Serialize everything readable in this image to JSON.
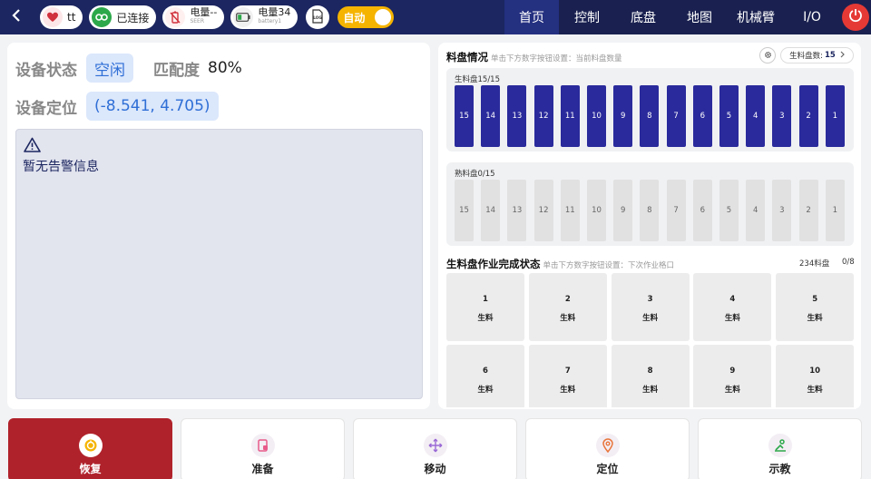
{
  "header": {
    "user": "tt",
    "connection": "已连接",
    "battery_a_label": "电量--",
    "battery_a_sub": "SEER",
    "battery_b_label": "电量34",
    "battery_b_sub": "battery1",
    "log_label": "LOG",
    "auto_label": "自动"
  },
  "nav": {
    "tabs": [
      "首页",
      "控制",
      "底盘",
      "地图",
      "机械臂",
      "I/O"
    ],
    "active": "首页"
  },
  "status": {
    "state_label": "设备状态",
    "state_value": "空闲",
    "match_label": "匹配度",
    "match_value": "80%",
    "position_label": "设备定位",
    "position_value": "(-8.541, 4.705)",
    "alarm_text": "暂无告警信息"
  },
  "trays": {
    "title": "料盘情况",
    "hint": "单击下方数字按钮设置：当前料盘数量",
    "count_label": "生料盘数:",
    "count_value": "15",
    "raw_caption": "生料盘15/15",
    "cooked_caption": "熟料盘0/15",
    "raw_slots": [
      "15",
      "14",
      "13",
      "12",
      "11",
      "10",
      "9",
      "8",
      "7",
      "6",
      "5",
      "4",
      "3",
      "2",
      "1"
    ],
    "cooked_slots": [
      "15",
      "14",
      "13",
      "12",
      "11",
      "10",
      "9",
      "8",
      "7",
      "6",
      "5",
      "4",
      "3",
      "2",
      "1"
    ]
  },
  "jobs": {
    "title": "生料盘作业完成状态",
    "hint": "单击下方数字按钮设置：下次作业格口",
    "total": "234料盘",
    "progress": "0/8",
    "cells": [
      {
        "num": "1",
        "kind": "生料"
      },
      {
        "num": "2",
        "kind": "生料"
      },
      {
        "num": "3",
        "kind": "生料"
      },
      {
        "num": "4",
        "kind": "生料"
      },
      {
        "num": "5",
        "kind": "生料"
      },
      {
        "num": "6",
        "kind": "生料"
      },
      {
        "num": "7",
        "kind": "生料"
      },
      {
        "num": "8",
        "kind": "生料"
      },
      {
        "num": "9",
        "kind": "生料"
      },
      {
        "num": "10",
        "kind": "生料"
      }
    ]
  },
  "actions": [
    {
      "label": "恢复",
      "icon": "restore-icon"
    },
    {
      "label": "准备",
      "icon": "prepare-icon"
    },
    {
      "label": "移动",
      "icon": "move-icon"
    },
    {
      "label": "定位",
      "icon": "location-pin-icon"
    },
    {
      "label": "示教",
      "icon": "teach-icon"
    }
  ],
  "colors": {
    "topbar": "#1c2660",
    "accent_blue": "#2f6fd6",
    "raw_tray": "#2a2a9c",
    "auto_toggle": "#f5b400",
    "restore_button": "#b0222b",
    "stop_button": "#e53935"
  }
}
